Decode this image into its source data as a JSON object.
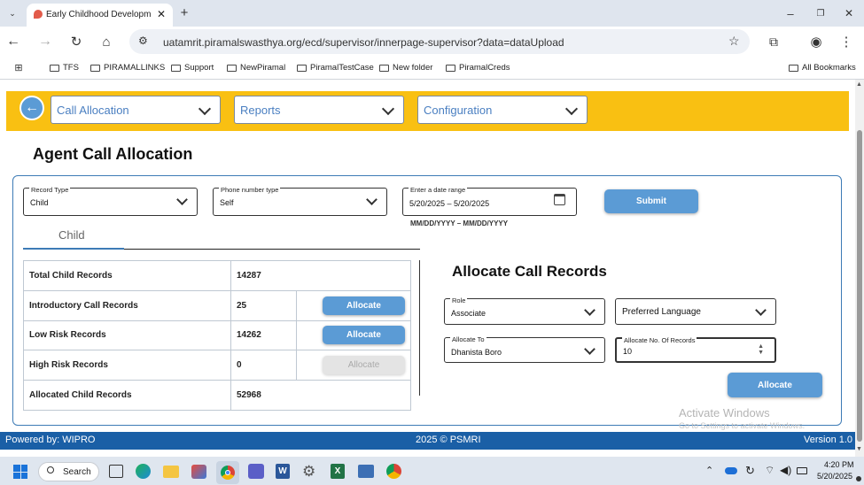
{
  "browser": {
    "tab_title": "Early Childhood Developme",
    "url": "uatamrit.piramalswasthya.org/ecd/supervisor/innerpage-supervisor?data=dataUpload",
    "bookmarks": [
      "TFS",
      "PIRAMALLINKS",
      "Support",
      "NewPiramal",
      "PiramalTestCase",
      "New folder",
      "PiramalCreds"
    ],
    "all_bookmarks": "All Bookmarks"
  },
  "nav": {
    "menus": [
      "Call Allocation",
      "Reports",
      "Configuration"
    ]
  },
  "page": {
    "title": "Agent Call Allocation",
    "filters": {
      "record_type": {
        "label": "Record Type",
        "value": "Child"
      },
      "phone_type": {
        "label": "Phone number type",
        "value": "Self"
      },
      "date_range": {
        "label": "Enter a date range",
        "value": "5/20/2025 – 5/20/2025",
        "hint": "MM/DD/YYYY – MM/DD/YYYY"
      },
      "submit_label": "Submit"
    },
    "tab_label": "Child",
    "records": [
      {
        "label": "Total Child Records",
        "value": "14287",
        "action": null
      },
      {
        "label": "Introductory Call Records",
        "value": "25",
        "action": "Allocate",
        "enabled": true
      },
      {
        "label": "Low Risk Records",
        "value": "14262",
        "action": "Allocate",
        "enabled": true
      },
      {
        "label": "High Risk Records",
        "value": "0",
        "action": "Allocate",
        "enabled": false
      },
      {
        "label": "Allocated Child Records",
        "value": "52968",
        "action": null
      }
    ],
    "allocate": {
      "title": "Allocate Call Records",
      "role": {
        "label": "Role",
        "value": "Associate"
      },
      "language": {
        "placeholder": "Preferred Language"
      },
      "allocate_to": {
        "label": "Allocate To",
        "value": "Dhanista Boro"
      },
      "allocate_no": {
        "label": "Allocate No. Of Records",
        "value": "10"
      },
      "button_label": "Allocate"
    },
    "watermark": {
      "line1": "Activate Windows",
      "line2": "Go to Settings to activate Windows."
    }
  },
  "footer": {
    "powered": "Powered by: WIPRO",
    "copyright": "2025 © PSMRI",
    "version": "Version 1.0"
  },
  "taskbar": {
    "search_label": "Search",
    "time": "4:20 PM",
    "date": "5/20/2025"
  },
  "colors": {
    "nav_band": "#f9c012",
    "accent": "#5b9bd5",
    "footer": "#1a5fa6"
  }
}
